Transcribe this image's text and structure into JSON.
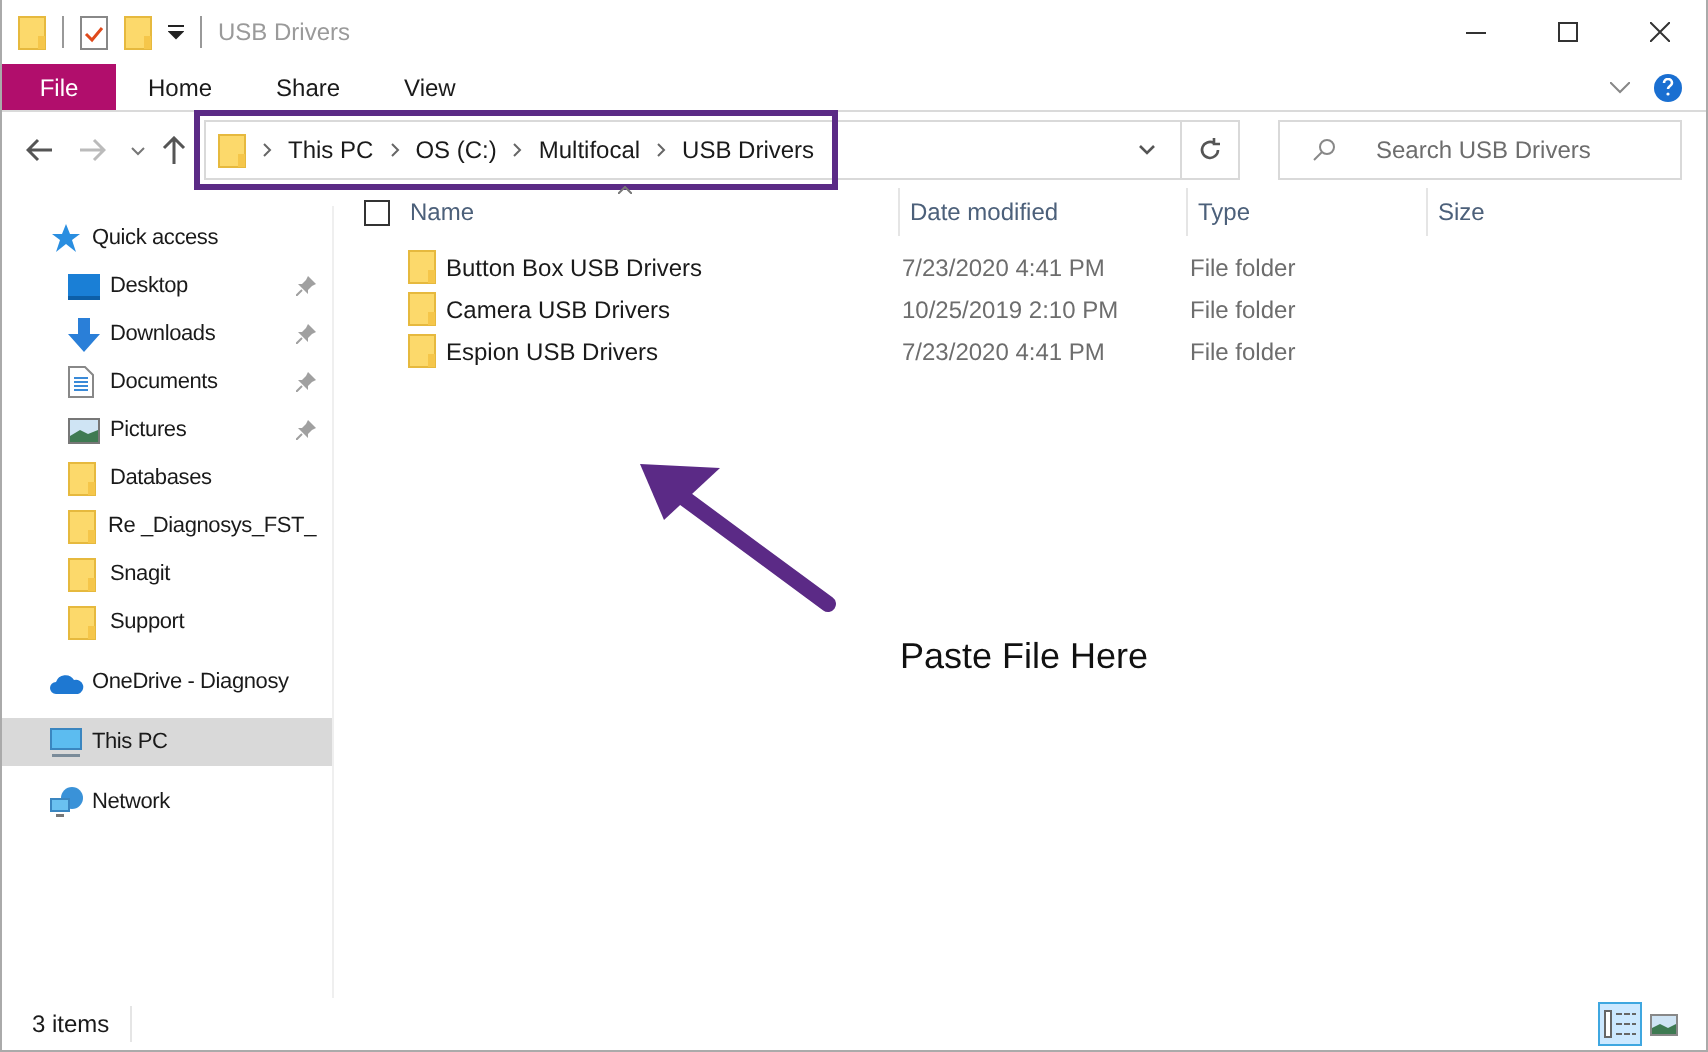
{
  "window": {
    "title": "USB Drivers"
  },
  "ribbon_tabs": [
    {
      "label": "File",
      "kind": "file",
      "selected": false
    },
    {
      "label": "Home",
      "kind": "tab",
      "selected": false
    },
    {
      "label": "Share",
      "kind": "tab",
      "selected": false
    },
    {
      "label": "View",
      "kind": "tab",
      "selected": false
    }
  ],
  "address": {
    "breadcrumbs": [
      "This PC",
      "OS (C:)",
      "Multifocal",
      "USB Drivers"
    ],
    "highlighted": true
  },
  "search": {
    "placeholder": "Search USB Drivers"
  },
  "sidebar": {
    "items": [
      {
        "label": "Quick access",
        "kind": "star",
        "selected": false,
        "children": [
          {
            "label": "Desktop",
            "kind": "desktop",
            "pinned": true,
            "selected": false
          },
          {
            "label": "Downloads",
            "kind": "download",
            "pinned": true,
            "selected": false
          },
          {
            "label": "Documents",
            "kind": "document",
            "pinned": true,
            "selected": false
          },
          {
            "label": "Pictures",
            "kind": "pictures",
            "pinned": true,
            "selected": false
          },
          {
            "label": "Databases",
            "kind": "folder",
            "pinned": false,
            "selected": false
          },
          {
            "label": "Re _Diagnosys_FST_",
            "kind": "folder",
            "pinned": false,
            "selected": false
          },
          {
            "label": "Snagit",
            "kind": "folder",
            "pinned": false,
            "selected": false
          },
          {
            "label": "Support",
            "kind": "folder",
            "pinned": false,
            "selected": false
          }
        ]
      },
      {
        "label": "OneDrive - Diagnosy",
        "kind": "cloud",
        "selected": false
      },
      {
        "label": "This PC",
        "kind": "pc",
        "selected": true
      },
      {
        "label": "Network",
        "kind": "network",
        "selected": false
      }
    ]
  },
  "table": {
    "select_all_checked": false,
    "columns": [
      "Name",
      "Date modified",
      "Type",
      "Size"
    ],
    "rows": [
      {
        "name": "Button Box USB Drivers",
        "date": "7/23/2020 4:41 PM",
        "type": "File folder"
      },
      {
        "name": "Camera USB Drivers",
        "date": "10/25/2019 2:10 PM",
        "type": "File folder"
      },
      {
        "name": "Espion USB Drivers",
        "date": "7/23/2020 4:41 PM",
        "type": "File folder"
      }
    ]
  },
  "annotation": {
    "text": "Paste File Here"
  },
  "status_bar": {
    "count": "3 items",
    "views": [
      {
        "kind": "details",
        "selected": true
      },
      {
        "kind": "large",
        "selected": false
      }
    ]
  }
}
